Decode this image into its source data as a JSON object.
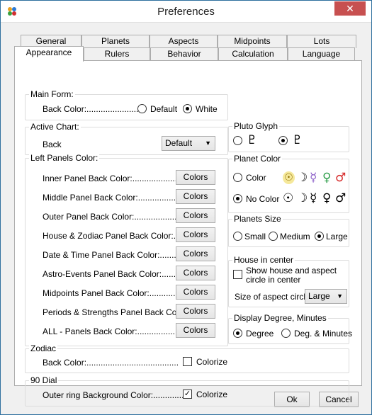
{
  "window": {
    "title": "Preferences",
    "close_glyph": "✕"
  },
  "tabs_row1": [
    "General",
    "Planets",
    "Aspects",
    "Midpoints",
    "Lots"
  ],
  "tabs_row2": [
    "Appearance",
    "Rulers",
    "Behavior",
    "Calculation",
    "Language"
  ],
  "main_form": {
    "title": "Main Form:",
    "back_color_label": "Back Color:........................",
    "opt_default": "Default",
    "opt_white": "White"
  },
  "active_chart": {
    "title": "Active Chart:",
    "back_label": "Back",
    "back_value": "Default"
  },
  "left_panels": {
    "title": "Left Panels Color:",
    "button_label": "Colors",
    "rows": [
      "Inner Panel Back Color:........................",
      "Middle Panel Back Color:......................",
      "Outer Panel Back Color:........................",
      "House & Zodiac Panel Back Color:....",
      "Date & Time Panel Back Color:..........",
      "Astro-Events Panel Back Color:..........",
      "Midpoints Panel Back Color:...............",
      "Periods & Strengths Panel Back Color:",
      "ALL -  Panels Back Color:....................."
    ]
  },
  "zodiac": {
    "title": "Zodiac",
    "back_label": "Back Color:.......................................",
    "colorize_label": "Colorize",
    "colorize_checked": false
  },
  "dial90": {
    "title": "90 Dial",
    "label": "Outer ring Background Color:...............",
    "colorize_label": "Colorize",
    "colorize_checked": true
  },
  "pluto_glyph": {
    "title": "Pluto Glyph",
    "glyph1": "♇",
    "glyph2": "♇"
  },
  "planet_color": {
    "title": "Planet Color",
    "opt_color": "Color",
    "opt_no_color": "No Color",
    "glyphs": [
      "☉",
      "☽",
      "☿",
      "♀",
      "♂"
    ],
    "colors": {
      "sun": "#f5e89a",
      "mercury": "#8a5cc7",
      "venus": "#2e9e4a",
      "mars": "#d62a2a"
    }
  },
  "planets_size": {
    "title": "Planets Size",
    "opt_small": "Small",
    "opt_medium": "Medium",
    "opt_large": "Large"
  },
  "house_center": {
    "title": "House in center",
    "show_label_line1": "Show house and aspect",
    "show_label_line2": "circle in center",
    "size_label": "Size of aspect circle:",
    "size_value": "Large"
  },
  "display_degree": {
    "title": "Display Degree, Minutes",
    "opt_degree": "Degree",
    "opt_deg_min": "Deg. & Minutes"
  },
  "footer": {
    "ok_label": "Ok",
    "cancel_label": "Cancel"
  }
}
